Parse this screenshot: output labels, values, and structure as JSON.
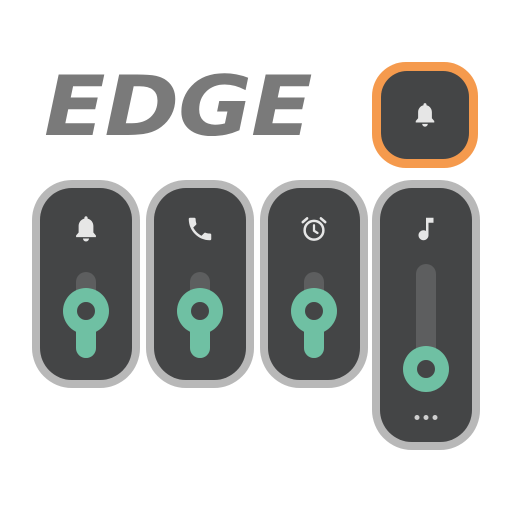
{
  "logo": {
    "text": "EDGE"
  },
  "header_button": {
    "icon": "bell-icon",
    "ring_color": "#f59a4d"
  },
  "volume_panels": [
    {
      "icon": "bell-icon",
      "level": 0.75,
      "expanded": false
    },
    {
      "icon": "phone-icon",
      "level": 0.75,
      "expanded": false
    },
    {
      "icon": "alarm-clock-icon",
      "level": 0.75,
      "expanded": false
    },
    {
      "icon": "music-note-icon",
      "level": 0.2,
      "expanded": true,
      "more_icon": "more-horizontal-icon"
    }
  ],
  "colors": {
    "panel_bg": "#444546",
    "panel_border": "#b8b8b8",
    "accent": "#6fc0a3",
    "track": "#5d5e5f",
    "logo": "#7a7a7a"
  }
}
